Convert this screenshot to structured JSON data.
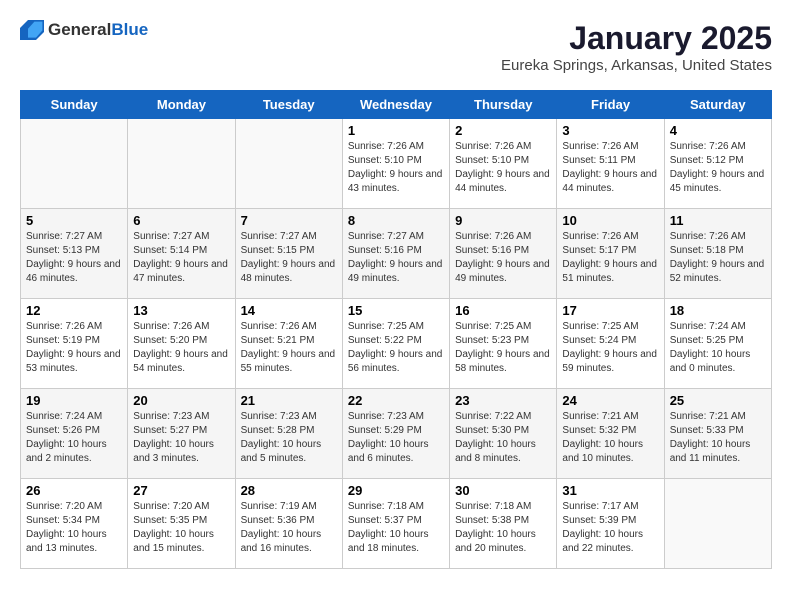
{
  "logo": {
    "general": "General",
    "blue": "Blue"
  },
  "header": {
    "month": "January 2025",
    "location": "Eureka Springs, Arkansas, United States"
  },
  "weekdays": [
    "Sunday",
    "Monday",
    "Tuesday",
    "Wednesday",
    "Thursday",
    "Friday",
    "Saturday"
  ],
  "weeks": [
    [
      {
        "day": "",
        "sunrise": "",
        "sunset": "",
        "daylight": ""
      },
      {
        "day": "",
        "sunrise": "",
        "sunset": "",
        "daylight": ""
      },
      {
        "day": "",
        "sunrise": "",
        "sunset": "",
        "daylight": ""
      },
      {
        "day": "1",
        "sunrise": "Sunrise: 7:26 AM",
        "sunset": "Sunset: 5:10 PM",
        "daylight": "Daylight: 9 hours and 43 minutes."
      },
      {
        "day": "2",
        "sunrise": "Sunrise: 7:26 AM",
        "sunset": "Sunset: 5:10 PM",
        "daylight": "Daylight: 9 hours and 44 minutes."
      },
      {
        "day": "3",
        "sunrise": "Sunrise: 7:26 AM",
        "sunset": "Sunset: 5:11 PM",
        "daylight": "Daylight: 9 hours and 44 minutes."
      },
      {
        "day": "4",
        "sunrise": "Sunrise: 7:26 AM",
        "sunset": "Sunset: 5:12 PM",
        "daylight": "Daylight: 9 hours and 45 minutes."
      }
    ],
    [
      {
        "day": "5",
        "sunrise": "Sunrise: 7:27 AM",
        "sunset": "Sunset: 5:13 PM",
        "daylight": "Daylight: 9 hours and 46 minutes."
      },
      {
        "day": "6",
        "sunrise": "Sunrise: 7:27 AM",
        "sunset": "Sunset: 5:14 PM",
        "daylight": "Daylight: 9 hours and 47 minutes."
      },
      {
        "day": "7",
        "sunrise": "Sunrise: 7:27 AM",
        "sunset": "Sunset: 5:15 PM",
        "daylight": "Daylight: 9 hours and 48 minutes."
      },
      {
        "day": "8",
        "sunrise": "Sunrise: 7:27 AM",
        "sunset": "Sunset: 5:16 PM",
        "daylight": "Daylight: 9 hours and 49 minutes."
      },
      {
        "day": "9",
        "sunrise": "Sunrise: 7:26 AM",
        "sunset": "Sunset: 5:16 PM",
        "daylight": "Daylight: 9 hours and 49 minutes."
      },
      {
        "day": "10",
        "sunrise": "Sunrise: 7:26 AM",
        "sunset": "Sunset: 5:17 PM",
        "daylight": "Daylight: 9 hours and 51 minutes."
      },
      {
        "day": "11",
        "sunrise": "Sunrise: 7:26 AM",
        "sunset": "Sunset: 5:18 PM",
        "daylight": "Daylight: 9 hours and 52 minutes."
      }
    ],
    [
      {
        "day": "12",
        "sunrise": "Sunrise: 7:26 AM",
        "sunset": "Sunset: 5:19 PM",
        "daylight": "Daylight: 9 hours and 53 minutes."
      },
      {
        "day": "13",
        "sunrise": "Sunrise: 7:26 AM",
        "sunset": "Sunset: 5:20 PM",
        "daylight": "Daylight: 9 hours and 54 minutes."
      },
      {
        "day": "14",
        "sunrise": "Sunrise: 7:26 AM",
        "sunset": "Sunset: 5:21 PM",
        "daylight": "Daylight: 9 hours and 55 minutes."
      },
      {
        "day": "15",
        "sunrise": "Sunrise: 7:25 AM",
        "sunset": "Sunset: 5:22 PM",
        "daylight": "Daylight: 9 hours and 56 minutes."
      },
      {
        "day": "16",
        "sunrise": "Sunrise: 7:25 AM",
        "sunset": "Sunset: 5:23 PM",
        "daylight": "Daylight: 9 hours and 58 minutes."
      },
      {
        "day": "17",
        "sunrise": "Sunrise: 7:25 AM",
        "sunset": "Sunset: 5:24 PM",
        "daylight": "Daylight: 9 hours and 59 minutes."
      },
      {
        "day": "18",
        "sunrise": "Sunrise: 7:24 AM",
        "sunset": "Sunset: 5:25 PM",
        "daylight": "Daylight: 10 hours and 0 minutes."
      }
    ],
    [
      {
        "day": "19",
        "sunrise": "Sunrise: 7:24 AM",
        "sunset": "Sunset: 5:26 PM",
        "daylight": "Daylight: 10 hours and 2 minutes."
      },
      {
        "day": "20",
        "sunrise": "Sunrise: 7:23 AM",
        "sunset": "Sunset: 5:27 PM",
        "daylight": "Daylight: 10 hours and 3 minutes."
      },
      {
        "day": "21",
        "sunrise": "Sunrise: 7:23 AM",
        "sunset": "Sunset: 5:28 PM",
        "daylight": "Daylight: 10 hours and 5 minutes."
      },
      {
        "day": "22",
        "sunrise": "Sunrise: 7:23 AM",
        "sunset": "Sunset: 5:29 PM",
        "daylight": "Daylight: 10 hours and 6 minutes."
      },
      {
        "day": "23",
        "sunrise": "Sunrise: 7:22 AM",
        "sunset": "Sunset: 5:30 PM",
        "daylight": "Daylight: 10 hours and 8 minutes."
      },
      {
        "day": "24",
        "sunrise": "Sunrise: 7:21 AM",
        "sunset": "Sunset: 5:32 PM",
        "daylight": "Daylight: 10 hours and 10 minutes."
      },
      {
        "day": "25",
        "sunrise": "Sunrise: 7:21 AM",
        "sunset": "Sunset: 5:33 PM",
        "daylight": "Daylight: 10 hours and 11 minutes."
      }
    ],
    [
      {
        "day": "26",
        "sunrise": "Sunrise: 7:20 AM",
        "sunset": "Sunset: 5:34 PM",
        "daylight": "Daylight: 10 hours and 13 minutes."
      },
      {
        "day": "27",
        "sunrise": "Sunrise: 7:20 AM",
        "sunset": "Sunset: 5:35 PM",
        "daylight": "Daylight: 10 hours and 15 minutes."
      },
      {
        "day": "28",
        "sunrise": "Sunrise: 7:19 AM",
        "sunset": "Sunset: 5:36 PM",
        "daylight": "Daylight: 10 hours and 16 minutes."
      },
      {
        "day": "29",
        "sunrise": "Sunrise: 7:18 AM",
        "sunset": "Sunset: 5:37 PM",
        "daylight": "Daylight: 10 hours and 18 minutes."
      },
      {
        "day": "30",
        "sunrise": "Sunrise: 7:18 AM",
        "sunset": "Sunset: 5:38 PM",
        "daylight": "Daylight: 10 hours and 20 minutes."
      },
      {
        "day": "31",
        "sunrise": "Sunrise: 7:17 AM",
        "sunset": "Sunset: 5:39 PM",
        "daylight": "Daylight: 10 hours and 22 minutes."
      },
      {
        "day": "",
        "sunrise": "",
        "sunset": "",
        "daylight": ""
      }
    ]
  ]
}
